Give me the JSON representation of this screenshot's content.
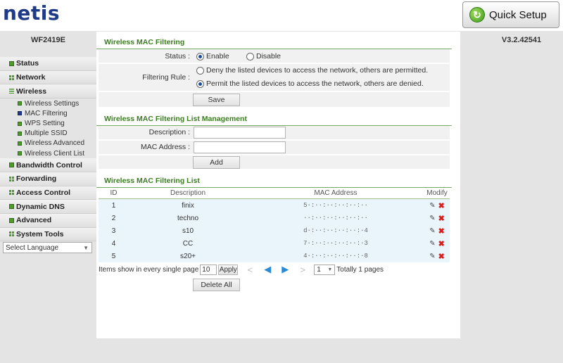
{
  "header": {
    "logo": "netis",
    "quick_setup": {
      "label": "Quick Setup",
      "icon": "arrow-circle-icon"
    }
  },
  "device": {
    "model": "WF2419E",
    "version": "V3.2.42541"
  },
  "sidebar": {
    "items": [
      {
        "label": "Status",
        "icon": "square-icon"
      },
      {
        "label": "Network",
        "icon": "grid-icon"
      },
      {
        "label": "Wireless",
        "icon": "lines-icon",
        "subitems": [
          {
            "label": "Wireless Settings"
          },
          {
            "label": "MAC Filtering",
            "active": true
          },
          {
            "label": "WPS Setting"
          },
          {
            "label": "Multiple SSID"
          },
          {
            "label": "Wireless Advanced"
          },
          {
            "label": "Wireless Client List"
          }
        ]
      },
      {
        "label": "Bandwidth Control",
        "icon": "square-icon"
      },
      {
        "label": "Forwarding",
        "icon": "grid-icon"
      },
      {
        "label": "Access Control",
        "icon": "grid-icon"
      },
      {
        "label": "Dynamic DNS",
        "icon": "square-icon"
      },
      {
        "label": "Advanced",
        "icon": "square-icon"
      },
      {
        "label": "System Tools",
        "icon": "grid-icon"
      }
    ],
    "language_select": "Select Language"
  },
  "filtering": {
    "title": "Wireless MAC Filtering",
    "status_label": "Status :",
    "status_options": [
      "Enable",
      "Disable"
    ],
    "status_selected": "Enable",
    "rule_label": "Filtering Rule :",
    "rule_options": [
      "Deny the listed devices to access the network, others are permitted.",
      "Permit the listed devices to access the network, others are denied."
    ],
    "rule_selected_index": 1,
    "save_label": "Save"
  },
  "management": {
    "title": "Wireless MAC Filtering List Management",
    "description_label": "Description :",
    "mac_label": "MAC Address :",
    "description_value": "",
    "mac_value": "",
    "add_label": "Add"
  },
  "list": {
    "title": "Wireless MAC Filtering List",
    "columns": [
      "ID",
      "Description",
      "MAC Address",
      "Modify"
    ],
    "rows": [
      {
        "id": "1",
        "description": "finix",
        "mac": "5·:··:··:··:··:··"
      },
      {
        "id": "2",
        "description": "techno",
        "mac": "··:··:··:··:··:··"
      },
      {
        "id": "3",
        "description": "s10",
        "mac": "d·:··:··:··:··:·4"
      },
      {
        "id": "4",
        "description": "CC",
        "mac": "7·:··:··:··:··:·3"
      },
      {
        "id": "5",
        "description": "s20+",
        "mac": "4·:··:··:··:··:·8"
      }
    ],
    "pager": {
      "items_label": "Items show in every single page",
      "per_page": "10",
      "apply_label": "Apply",
      "page": "1",
      "total_text": "Totally 1 pages"
    },
    "delete_all_label": "Delete All"
  },
  "colors": {
    "section_title": "#3a7d1f",
    "brand": "#1f3a86",
    "delete": "#d62020",
    "nav_arrow": "#2a8ad4"
  }
}
